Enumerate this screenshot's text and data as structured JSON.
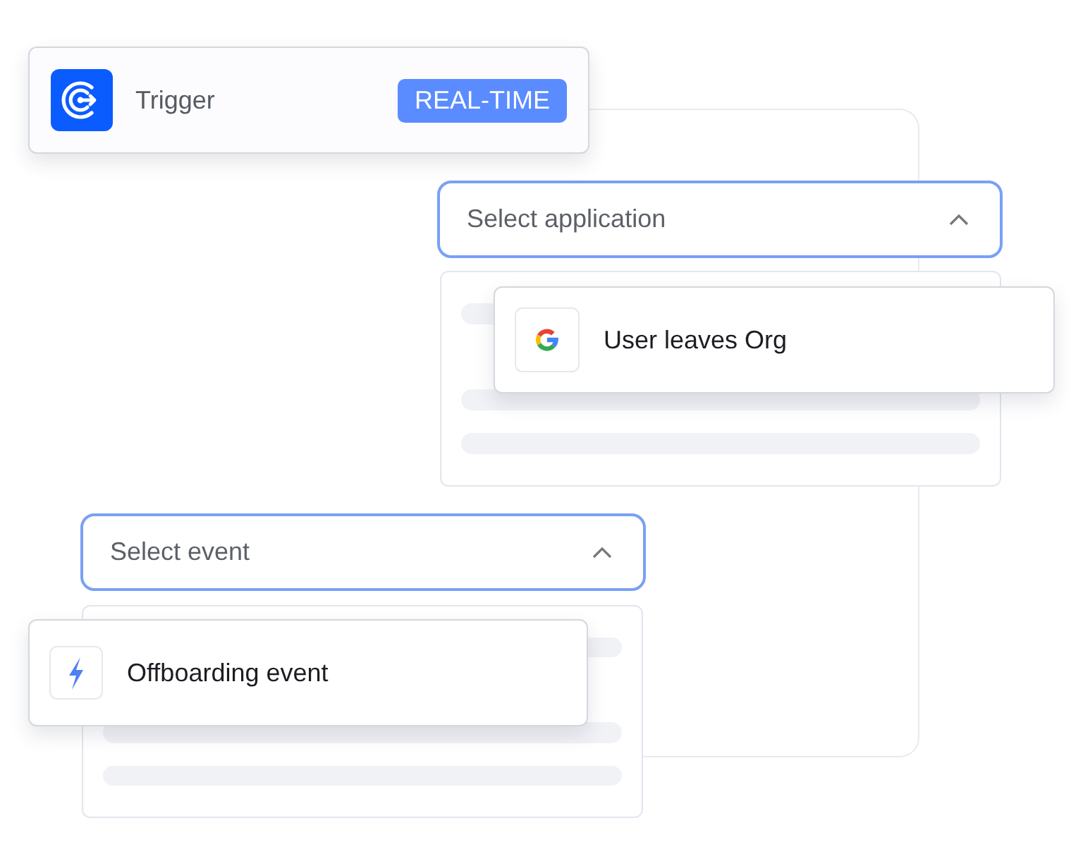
{
  "trigger": {
    "label": "Trigger",
    "badge": "REAL-TIME"
  },
  "application_select": {
    "placeholder": "Select application",
    "expanded": true
  },
  "application_option": {
    "label": "User leaves Org"
  },
  "event_select": {
    "placeholder": "Select event",
    "expanded": true
  },
  "event_option": {
    "label": "Offboarding event"
  }
}
